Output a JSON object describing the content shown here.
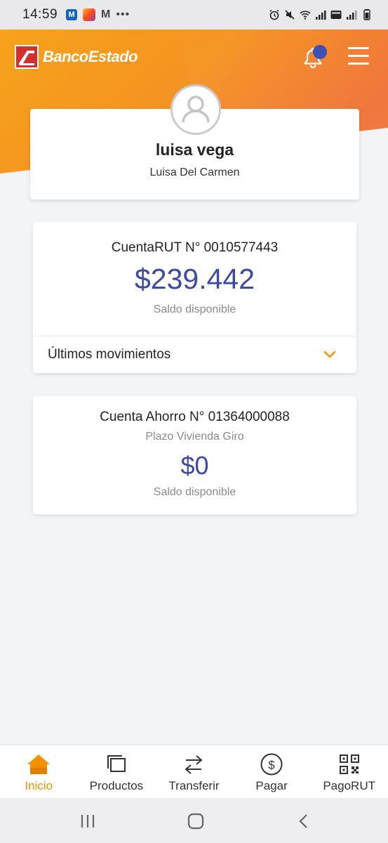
{
  "status_bar": {
    "time": "14:59",
    "left_icons": [
      "mercadopago-icon",
      "photos-icon",
      "gmail-icon",
      "more-dots-icon"
    ],
    "right_icons": [
      "alarm-icon",
      "mute-icon",
      "wifi-icon",
      "signal-icon",
      "volte-icon",
      "signal-icon",
      "battery-icon"
    ],
    "gmail_glyph": "M",
    "dots": "•••"
  },
  "header": {
    "brand": "BancoEstado",
    "icons": [
      "notification-bell-icon",
      "hamburger-menu-icon"
    ],
    "colors": {
      "brand_orange": "#f39200",
      "accent_blue": "#3f51b5"
    }
  },
  "profile": {
    "name": "luisa vega",
    "subtitle": "Luisa Del Carmen",
    "avatar_icon": "user-avatar-icon"
  },
  "accounts": [
    {
      "title": "CuentaRUT N° 0010577443",
      "amount": "$239.442",
      "label": "Saldo disponible",
      "movements_label": "Últimos movimientos",
      "movements_icon": "chevron-down-icon"
    },
    {
      "title": "Cuenta Ahorro N° 01364000088",
      "subtitle": "Plazo Vivienda Giro",
      "amount": "$0",
      "label": "Saldo disponible"
    }
  ],
  "bottom_nav": [
    {
      "label": "Inicio",
      "icon": "home-icon",
      "active": true
    },
    {
      "label": "Productos",
      "icon": "products-icon",
      "active": false
    },
    {
      "label": "Transferir",
      "icon": "transfer-icon",
      "active": false
    },
    {
      "label": "Pagar",
      "icon": "pay-icon",
      "active": false
    },
    {
      "label": "PagoRUT",
      "icon": "qr-code-icon",
      "active": false
    }
  ],
  "system_nav": [
    "recent-apps-icon",
    "home-button-icon",
    "back-icon"
  ]
}
